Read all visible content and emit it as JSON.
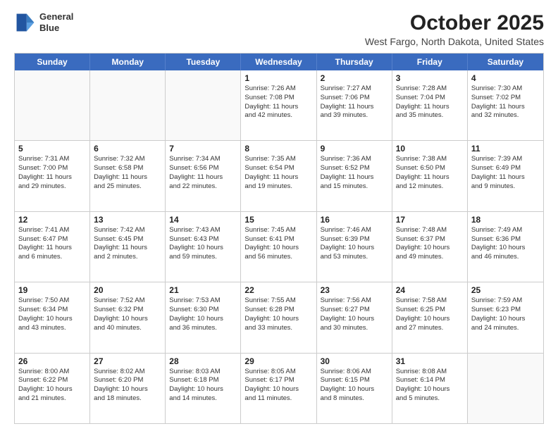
{
  "header": {
    "logo_line1": "General",
    "logo_line2": "Blue",
    "title": "October 2025",
    "subtitle": "West Fargo, North Dakota, United States"
  },
  "weekdays": [
    "Sunday",
    "Monday",
    "Tuesday",
    "Wednesday",
    "Thursday",
    "Friday",
    "Saturday"
  ],
  "rows": [
    [
      {
        "day": "",
        "info": ""
      },
      {
        "day": "",
        "info": ""
      },
      {
        "day": "",
        "info": ""
      },
      {
        "day": "1",
        "info": "Sunrise: 7:26 AM\nSunset: 7:08 PM\nDaylight: 11 hours\nand 42 minutes."
      },
      {
        "day": "2",
        "info": "Sunrise: 7:27 AM\nSunset: 7:06 PM\nDaylight: 11 hours\nand 39 minutes."
      },
      {
        "day": "3",
        "info": "Sunrise: 7:28 AM\nSunset: 7:04 PM\nDaylight: 11 hours\nand 35 minutes."
      },
      {
        "day": "4",
        "info": "Sunrise: 7:30 AM\nSunset: 7:02 PM\nDaylight: 11 hours\nand 32 minutes."
      }
    ],
    [
      {
        "day": "5",
        "info": "Sunrise: 7:31 AM\nSunset: 7:00 PM\nDaylight: 11 hours\nand 29 minutes."
      },
      {
        "day": "6",
        "info": "Sunrise: 7:32 AM\nSunset: 6:58 PM\nDaylight: 11 hours\nand 25 minutes."
      },
      {
        "day": "7",
        "info": "Sunrise: 7:34 AM\nSunset: 6:56 PM\nDaylight: 11 hours\nand 22 minutes."
      },
      {
        "day": "8",
        "info": "Sunrise: 7:35 AM\nSunset: 6:54 PM\nDaylight: 11 hours\nand 19 minutes."
      },
      {
        "day": "9",
        "info": "Sunrise: 7:36 AM\nSunset: 6:52 PM\nDaylight: 11 hours\nand 15 minutes."
      },
      {
        "day": "10",
        "info": "Sunrise: 7:38 AM\nSunset: 6:50 PM\nDaylight: 11 hours\nand 12 minutes."
      },
      {
        "day": "11",
        "info": "Sunrise: 7:39 AM\nSunset: 6:49 PM\nDaylight: 11 hours\nand 9 minutes."
      }
    ],
    [
      {
        "day": "12",
        "info": "Sunrise: 7:41 AM\nSunset: 6:47 PM\nDaylight: 11 hours\nand 6 minutes."
      },
      {
        "day": "13",
        "info": "Sunrise: 7:42 AM\nSunset: 6:45 PM\nDaylight: 11 hours\nand 2 minutes."
      },
      {
        "day": "14",
        "info": "Sunrise: 7:43 AM\nSunset: 6:43 PM\nDaylight: 10 hours\nand 59 minutes."
      },
      {
        "day": "15",
        "info": "Sunrise: 7:45 AM\nSunset: 6:41 PM\nDaylight: 10 hours\nand 56 minutes."
      },
      {
        "day": "16",
        "info": "Sunrise: 7:46 AM\nSunset: 6:39 PM\nDaylight: 10 hours\nand 53 minutes."
      },
      {
        "day": "17",
        "info": "Sunrise: 7:48 AM\nSunset: 6:37 PM\nDaylight: 10 hours\nand 49 minutes."
      },
      {
        "day": "18",
        "info": "Sunrise: 7:49 AM\nSunset: 6:36 PM\nDaylight: 10 hours\nand 46 minutes."
      }
    ],
    [
      {
        "day": "19",
        "info": "Sunrise: 7:50 AM\nSunset: 6:34 PM\nDaylight: 10 hours\nand 43 minutes."
      },
      {
        "day": "20",
        "info": "Sunrise: 7:52 AM\nSunset: 6:32 PM\nDaylight: 10 hours\nand 40 minutes."
      },
      {
        "day": "21",
        "info": "Sunrise: 7:53 AM\nSunset: 6:30 PM\nDaylight: 10 hours\nand 36 minutes."
      },
      {
        "day": "22",
        "info": "Sunrise: 7:55 AM\nSunset: 6:28 PM\nDaylight: 10 hours\nand 33 minutes."
      },
      {
        "day": "23",
        "info": "Sunrise: 7:56 AM\nSunset: 6:27 PM\nDaylight: 10 hours\nand 30 minutes."
      },
      {
        "day": "24",
        "info": "Sunrise: 7:58 AM\nSunset: 6:25 PM\nDaylight: 10 hours\nand 27 minutes."
      },
      {
        "day": "25",
        "info": "Sunrise: 7:59 AM\nSunset: 6:23 PM\nDaylight: 10 hours\nand 24 minutes."
      }
    ],
    [
      {
        "day": "26",
        "info": "Sunrise: 8:00 AM\nSunset: 6:22 PM\nDaylight: 10 hours\nand 21 minutes."
      },
      {
        "day": "27",
        "info": "Sunrise: 8:02 AM\nSunset: 6:20 PM\nDaylight: 10 hours\nand 18 minutes."
      },
      {
        "day": "28",
        "info": "Sunrise: 8:03 AM\nSunset: 6:18 PM\nDaylight: 10 hours\nand 14 minutes."
      },
      {
        "day": "29",
        "info": "Sunrise: 8:05 AM\nSunset: 6:17 PM\nDaylight: 10 hours\nand 11 minutes."
      },
      {
        "day": "30",
        "info": "Sunrise: 8:06 AM\nSunset: 6:15 PM\nDaylight: 10 hours\nand 8 minutes."
      },
      {
        "day": "31",
        "info": "Sunrise: 8:08 AM\nSunset: 6:14 PM\nDaylight: 10 hours\nand 5 minutes."
      },
      {
        "day": "",
        "info": ""
      }
    ]
  ]
}
